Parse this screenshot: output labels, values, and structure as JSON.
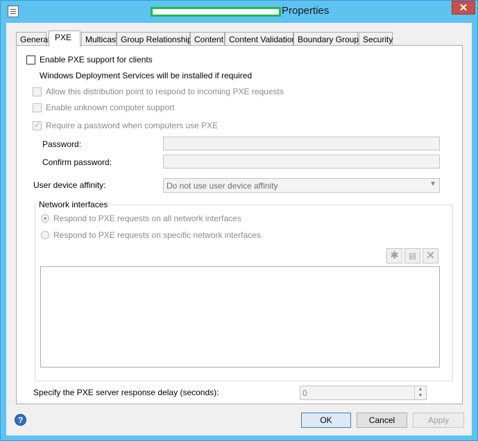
{
  "window": {
    "title": "Properties",
    "close_glyph": "✕"
  },
  "tabs": [
    {
      "label": "General"
    },
    {
      "label": "PXE"
    },
    {
      "label": "Multicast"
    },
    {
      "label": "Group Relationships"
    },
    {
      "label": "Content"
    },
    {
      "label": "Content Validation"
    },
    {
      "label": "Boundary Groups"
    },
    {
      "label": "Security"
    }
  ],
  "pxe": {
    "enable_pxe_label": "Enable PXE support for clients",
    "wds_note": "Windows Deployment Services will be installed if required",
    "allow_respond_label": "Allow this distribution point to respond to incoming PXE requests",
    "unknown_computer_label": "Enable unknown computer support",
    "require_password_label": "Require a password when computers use PXE",
    "password_label": "Password:",
    "confirm_password_label": "Confirm password:",
    "user_affinity_label": "User device affinity:",
    "user_affinity_value": "Do not use user device affinity",
    "network_interfaces_title": "Network interfaces",
    "respond_all_label": "Respond to PXE requests on all network interfaces",
    "respond_specific_label": "Respond to PXE requests on specific network interfaces",
    "delay_label": "Specify the PXE server response delay (seconds):",
    "delay_value": "0"
  },
  "toolbar_icons": [
    "new-icon",
    "properties-icon",
    "delete-icon"
  ],
  "buttons": {
    "ok": "OK",
    "cancel": "Cancel",
    "apply": "Apply"
  },
  "help_glyph": "?",
  "colors": {
    "titlebar": "#5ec3f0",
    "close": "#c7504a",
    "redaction_border": "#1db94a"
  }
}
